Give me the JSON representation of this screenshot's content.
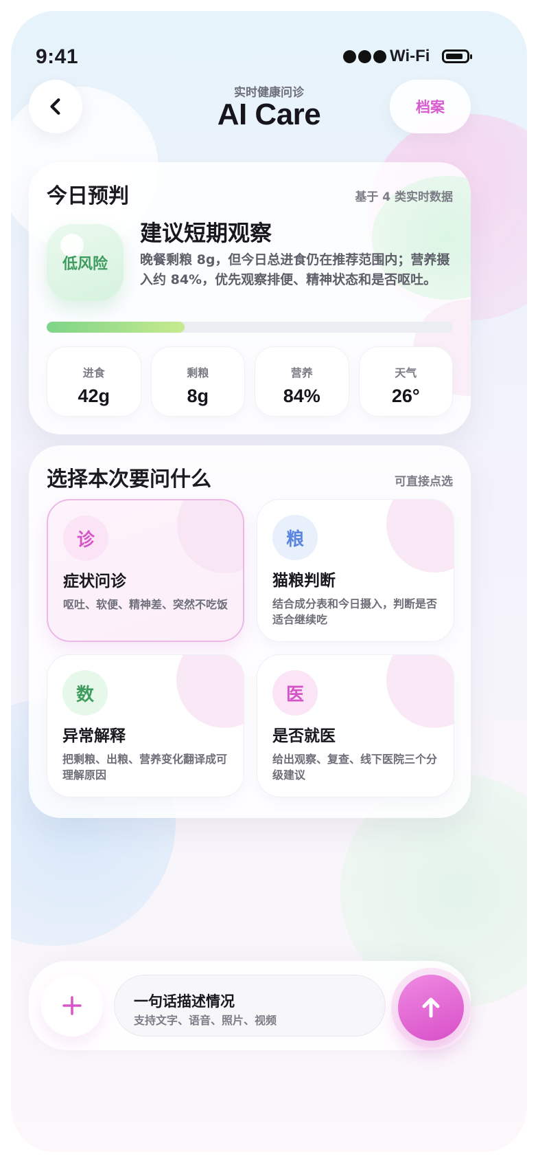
{
  "status_bar": {
    "time": "9:41",
    "wifi_label": "Wi-Fi",
    "icons": [
      "signal-dots-icon",
      "battery-icon"
    ]
  },
  "header": {
    "subtitle": "实时健康问诊",
    "title": "AI Care",
    "back_icon": "chevron-left-icon",
    "archive_label": "档案"
  },
  "prediction": {
    "heading": "今日预判",
    "data_hint": "基于 4 类实时数据",
    "risk_badge": "低风险",
    "title": "建议短期观察",
    "description": "晚餐剩粮 8g，但今日总进食仍在推荐范围内；营养摄入约 84%，优先观察排便、精神状态和是否呕吐。",
    "progress_fraction": 0.34,
    "stats": [
      {
        "label": "进食",
        "value": "42g"
      },
      {
        "label": "剩粮",
        "value": "8g"
      },
      {
        "label": "营养",
        "value": "84%"
      },
      {
        "label": "天气",
        "value": "26°"
      }
    ]
  },
  "options": {
    "heading": "选择本次要问什么",
    "hint": "可直接点选",
    "items": [
      {
        "icon_char": "诊",
        "title": "症状问诊",
        "desc": "呕吐、软便、精神差、突然不吃饭",
        "selected": true,
        "icon_color": "#d455c8",
        "icon_bg": "#fbe4f6"
      },
      {
        "icon_char": "粮",
        "title": "猫粮判断",
        "desc": "结合成分表和今日摄入，判断是否适合继续吃",
        "selected": false,
        "icon_color": "#5b86e0",
        "icon_bg": "#e8f0fc"
      },
      {
        "icon_char": "数",
        "title": "异常解释",
        "desc": "把剩粮、出粮、营养变化翻译成可理解原因",
        "selected": false,
        "icon_color": "#3f9b5e",
        "icon_bg": "#e6f8ea"
      },
      {
        "icon_char": "医",
        "title": "是否就医",
        "desc": "给出观察、复查、线下医院三个分级建议",
        "selected": false,
        "icon_color": "#d455c8",
        "icon_bg": "#fbe4f6"
      }
    ]
  },
  "composer": {
    "plus_icon": "plus-icon",
    "placeholder_main": "一句话描述情况",
    "placeholder_sub": "支持文字、语音、照片、视频",
    "send_icon": "arrow-up-icon"
  },
  "colors": {
    "accent": "#d855c8",
    "low_risk": "#3f9b5e",
    "progress_start": "#7dd488",
    "progress_end": "#c7ea8e"
  }
}
